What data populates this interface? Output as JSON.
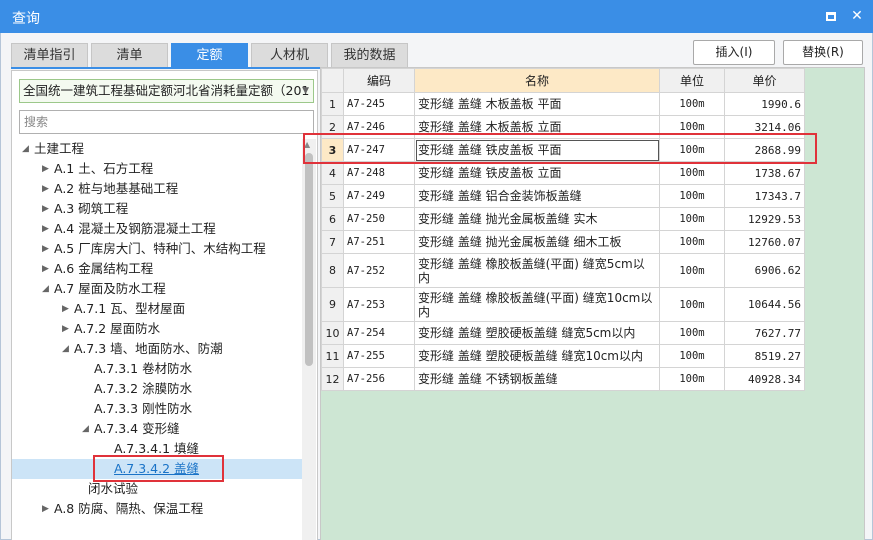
{
  "window": {
    "title": "查询"
  },
  "tabs": [
    {
      "label": "清单指引",
      "active": false
    },
    {
      "label": "清单",
      "active": false
    },
    {
      "label": "定额",
      "active": true
    },
    {
      "label": "人材机",
      "active": false
    },
    {
      "label": "我的数据",
      "active": false
    }
  ],
  "actions": {
    "insert_label": "插入(I)",
    "replace_label": "替换(R)"
  },
  "left": {
    "dropdown_value": "全国统一建筑工程基础定额河北省消耗量定额（201",
    "search_placeholder": "搜索",
    "tree": [
      {
        "label": "土建工程",
        "level": 0,
        "expanded": true
      },
      {
        "label": "A.1 土、石方工程",
        "level": 1,
        "expanded": false
      },
      {
        "label": "A.2 桩与地基基础工程",
        "level": 1,
        "expanded": false
      },
      {
        "label": "A.3 砌筑工程",
        "level": 1,
        "expanded": false
      },
      {
        "label": "A.4 混凝土及钢筋混凝土工程",
        "level": 1,
        "expanded": false
      },
      {
        "label": "A.5 厂库房大门、特种门、木结构工程",
        "level": 1,
        "expanded": false
      },
      {
        "label": "A.6 金属结构工程",
        "level": 1,
        "expanded": false
      },
      {
        "label": "A.7 屋面及防水工程",
        "level": 1,
        "expanded": true
      },
      {
        "label": "A.7.1 瓦、型材屋面",
        "level": 2,
        "expanded": false
      },
      {
        "label": "A.7.2 屋面防水",
        "level": 2,
        "expanded": false
      },
      {
        "label": "A.7.3 墙、地面防水、防潮",
        "level": 2,
        "expanded": true
      },
      {
        "label": "A.7.3.1 卷材防水",
        "level": 3,
        "leaf": true
      },
      {
        "label": "A.7.3.2 涂膜防水",
        "level": 3,
        "leaf": true
      },
      {
        "label": "A.7.3.3 刚性防水",
        "level": 3,
        "leaf": true
      },
      {
        "label": "A.7.3.4 变形缝",
        "level": 3,
        "expanded": true
      },
      {
        "label": "A.7.3.4.1 填缝",
        "level": 4,
        "leaf": true
      },
      {
        "label": "A.7.3.4.2 盖缝",
        "level": 4,
        "leaf": true,
        "selected": true
      },
      {
        "label": "闭水试验",
        "level": 2.5,
        "leaf": true
      },
      {
        "label": "A.8 防腐、隔热、保温工程",
        "level": 1,
        "expanded": false
      }
    ]
  },
  "grid": {
    "headers": {
      "code": "编码",
      "name": "名称",
      "unit": "单位",
      "price": "单价"
    },
    "rows": [
      {
        "n": "1",
        "code": "A7-245",
        "name": "变形缝 盖缝 木板盖板 平面",
        "unit": "100m",
        "price": "1990.6"
      },
      {
        "n": "2",
        "code": "A7-246",
        "name": "变形缝 盖缝 木板盖板 立面",
        "unit": "100m",
        "price": "3214.06"
      },
      {
        "n": "3",
        "code": "A7-247",
        "name": "变形缝 盖缝 铁皮盖板 平面",
        "unit": "100m",
        "price": "2868.99",
        "selected": true
      },
      {
        "n": "4",
        "code": "A7-248",
        "name": "变形缝 盖缝 铁皮盖板 立面",
        "unit": "100m",
        "price": "1738.67"
      },
      {
        "n": "5",
        "code": "A7-249",
        "name": "变形缝 盖缝 铝合金装饰板盖缝",
        "unit": "100m",
        "price": "17343.7"
      },
      {
        "n": "6",
        "code": "A7-250",
        "name": "变形缝 盖缝 抛光金属板盖缝 实木",
        "unit": "100m",
        "price": "12929.53"
      },
      {
        "n": "7",
        "code": "A7-251",
        "name": "变形缝 盖缝 抛光金属板盖缝 细木工板",
        "unit": "100m",
        "price": "12760.07"
      },
      {
        "n": "8",
        "code": "A7-252",
        "name": "变形缝 盖缝 橡胶板盖缝(平面) 缝宽5cm以内",
        "unit": "100m",
        "price": "6906.62",
        "tall": true
      },
      {
        "n": "9",
        "code": "A7-253",
        "name": "变形缝 盖缝 橡胶板盖缝(平面) 缝宽10cm以内",
        "unit": "100m",
        "price": "10644.56",
        "tall": true
      },
      {
        "n": "10",
        "code": "A7-254",
        "name": "变形缝 盖缝 塑胶硬板盖缝 缝宽5cm以内",
        "unit": "100m",
        "price": "7627.77"
      },
      {
        "n": "11",
        "code": "A7-255",
        "name": "变形缝 盖缝 塑胶硬板盖缝 缝宽10cm以内",
        "unit": "100m",
        "price": "8519.27"
      },
      {
        "n": "12",
        "code": "A7-256",
        "name": "变形缝 盖缝 不锈钢板盖缝",
        "unit": "100m",
        "price": "40928.34"
      }
    ]
  },
  "colors": {
    "accent": "#3a8ee6",
    "highlight": "#e0323a",
    "grid_bg": "#cde6d3"
  }
}
